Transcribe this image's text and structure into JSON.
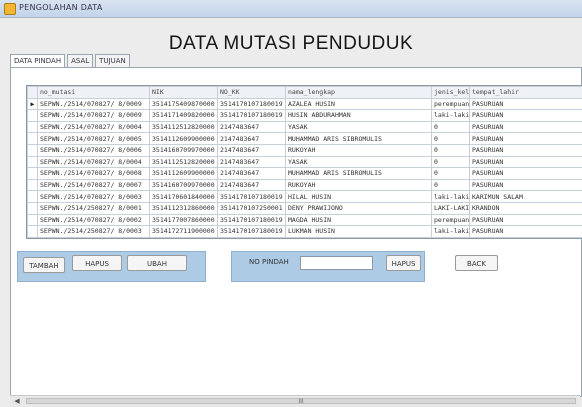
{
  "window": {
    "title": "PENGOLAHAN DATA"
  },
  "page": {
    "title": "DATA MUTASI PENDUDUK"
  },
  "tabs": [
    "DATA PINDAH",
    "ASAL",
    "TUJUAN"
  ],
  "table": {
    "columns": [
      "no_mutasi",
      "NIK",
      "NO_KK",
      "nama_lengkap",
      "jenis_kelamin",
      "tempat_lahir"
    ],
    "rows": [
      [
        "SEPWN./2514/070827/ 8/0009",
        "3514175409870000",
        "3514170107180019",
        "AZALEA HUSIN",
        "perempuan",
        "PASURUAN"
      ],
      [
        "SEPWN./2514/070827/ 8/0009",
        "3514171409820000",
        "3514170107180019",
        "HUSIN ABDURAHMAN",
        "laki-laki",
        "PASURUAN"
      ],
      [
        "SEPWN./2514/070827/ 8/0004",
        "3514112512820000",
        "2147483647",
        "YASAK",
        "0",
        "PASURUAN"
      ],
      [
        "SEPWN./2514/070827/ 8/0005",
        "3514112609900000",
        "2147483647",
        "MUHAMMAD ARIS SIBROMULIS",
        "0",
        "PASURUAN"
      ],
      [
        "SEPWN./2514/070827/ 8/0006",
        "3514160709970000",
        "2147483647",
        "RUKOYAH",
        "0",
        "PASURUAN"
      ],
      [
        "SEPWN./2514/070827/ 8/0004",
        "3514112512820000",
        "2147483647",
        "YASAK",
        "0",
        "PASURUAN"
      ],
      [
        "SEPWN./2514/070827/ 8/0008",
        "3514112609900000",
        "2147483647",
        "MUHAMMAD ARIS SIBROMULIS",
        "0",
        "PASURUAN"
      ],
      [
        "SEPWN./2514/070827/ 8/0007",
        "3514160709970000",
        "2147483647",
        "RUKOYAH",
        "0",
        "PASURUAN"
      ],
      [
        "SEPWN./2514/070827/ 8/0003",
        "3514170601840000",
        "3514170107180019",
        "HILAL HUSIN",
        "laki-laki",
        "KARIMUN SALAM"
      ],
      [
        "SEPWN./2514/250827/ 8/0001",
        "3514112312860000",
        "3514170107250001",
        "DENY PRAWIJONO",
        "LAKI-LAKI",
        "KRANDON"
      ],
      [
        "SEPWN./2514/070827/ 8/0002",
        "3514177007860000",
        "3514170107180019",
        "MAGDA HUSIN",
        "perempuan",
        "PASURUAN"
      ],
      [
        "SEPWN./2514/250827/ 8/0003",
        "3514172711900000",
        "3514170107180019",
        "LUKMAN HUSIN",
        "laki-laki",
        "PASURUAN"
      ]
    ]
  },
  "actions": {
    "tambah": "TAMBAH",
    "hapus": "HAPUS",
    "ubah": "UBAH",
    "no_pindah_label": "NO PINDAH",
    "no_pindah_value": "",
    "hapus2": "HAPUS",
    "back": "BACK"
  },
  "scrollbar": {
    "thumb_glyph": "III"
  }
}
